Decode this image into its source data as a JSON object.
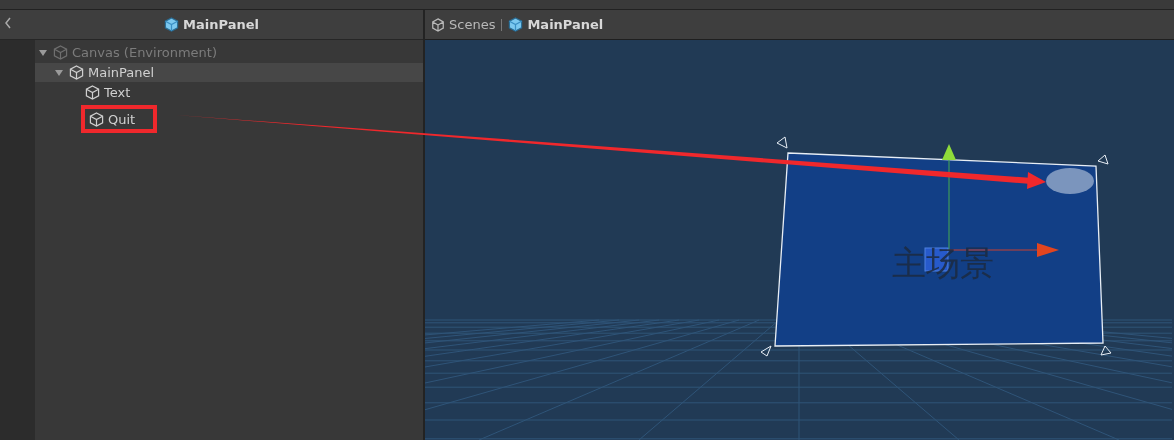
{
  "hierarchy": {
    "title": "MainPanel",
    "tree": [
      {
        "label": "Canvas (Environment)",
        "disabled": true,
        "selected": false,
        "annotated": false,
        "expanded": true,
        "children": [
          {
            "label": "MainPanel",
            "disabled": false,
            "selected": true,
            "annotated": false,
            "expanded": true,
            "children": [
              {
                "label": "Text",
                "disabled": false,
                "selected": false,
                "annotated": false
              },
              {
                "label": "Quit",
                "disabled": false,
                "selected": false,
                "annotated": true
              }
            ]
          }
        ]
      }
    ]
  },
  "scene": {
    "breadcrumb": [
      {
        "label": "Scenes",
        "kind": "scenes"
      },
      {
        "label": "MainPanel",
        "kind": "prefab"
      }
    ],
    "canvas_text": "主场景"
  }
}
